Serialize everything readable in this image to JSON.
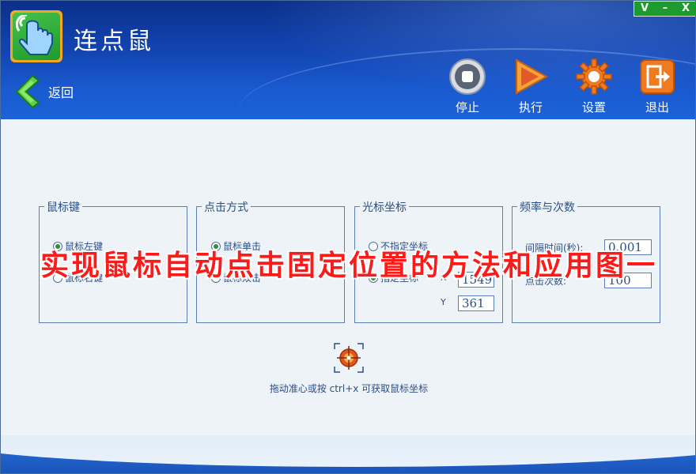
{
  "app": {
    "title": "连点鼠",
    "window_controls": [
      "V",
      "–",
      "X"
    ]
  },
  "nav": {
    "back_label": "返回"
  },
  "toolbar": {
    "stop_label": "停止",
    "run_label": "执行",
    "settings_label": "设置",
    "exit_label": "退出"
  },
  "mouse_button": {
    "legend": "鼠标键",
    "options": [
      "鼠标左键",
      "鼠标右键"
    ],
    "selected": "鼠标左键"
  },
  "click_mode": {
    "legend": "点击方式",
    "options": [
      "鼠标单击",
      "鼠标双击"
    ],
    "selected": "鼠标单击"
  },
  "cursor_coord": {
    "legend": "光标坐标",
    "options": [
      "不指定坐标",
      "指定坐标"
    ],
    "selected": "指定坐标",
    "x_label": "X",
    "y_label": "Y",
    "x_value": "1549",
    "y_value": "361"
  },
  "frequency": {
    "legend": "频率与次数",
    "interval_label": "间隔时间(秒):",
    "interval_value": "0.001",
    "count_label": "点击次数:",
    "count_value": "100"
  },
  "crosshair": {
    "icon": "crosshair-icon",
    "hint": "拖动准心或按 ctrl+x 可获取鼠标坐标"
  },
  "overlay_caption": "实现鼠标自动点击固定位置的方法和应用图一",
  "colors": {
    "header": "#1346b4",
    "accent_green": "#1e9b2f",
    "group_border": "#5a7fb8",
    "text_blue": "#2b4f86",
    "overlay_red": "#ff1a1a"
  }
}
